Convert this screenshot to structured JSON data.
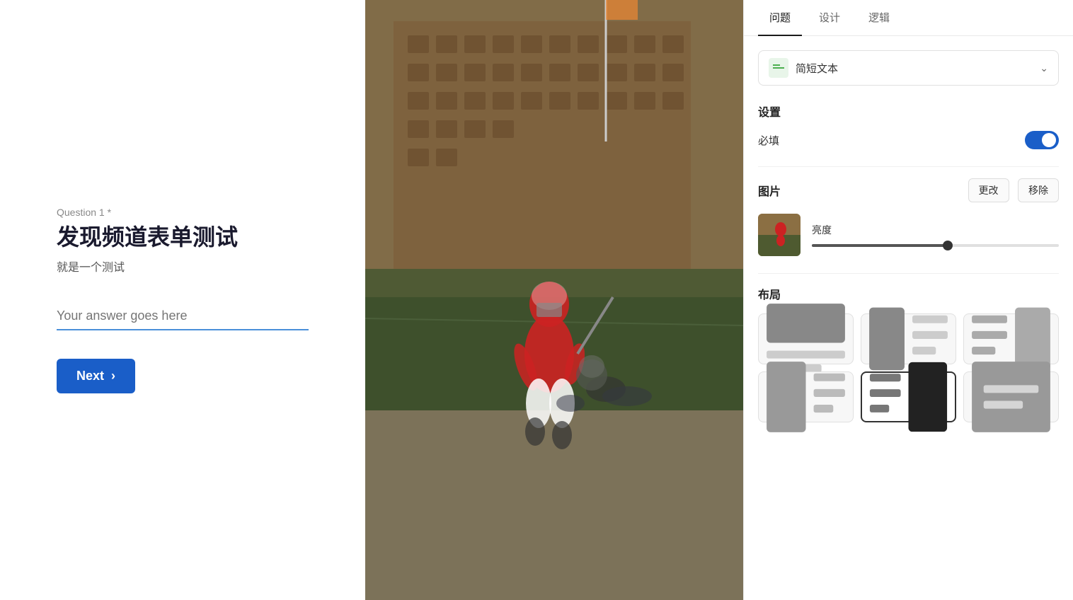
{
  "left": {
    "question_label": "Question 1 *",
    "question_title": "发现频道表单测试",
    "question_desc": "就是一个测试",
    "answer_placeholder": "Your answer goes here",
    "next_label": "Next"
  },
  "right": {
    "tabs": [
      {
        "id": "question",
        "label": "问题"
      },
      {
        "id": "design",
        "label": "设计"
      },
      {
        "id": "logic",
        "label": "逻辑"
      }
    ],
    "active_tab": "question",
    "type_selector": {
      "label": "简短文本"
    },
    "settings": {
      "label": "设置",
      "required_label": "必填"
    },
    "image_section": {
      "label": "图片",
      "change_btn": "更改",
      "remove_btn": "移除",
      "brightness_label": "亮度"
    },
    "layout_section": {
      "label": "布局"
    }
  }
}
